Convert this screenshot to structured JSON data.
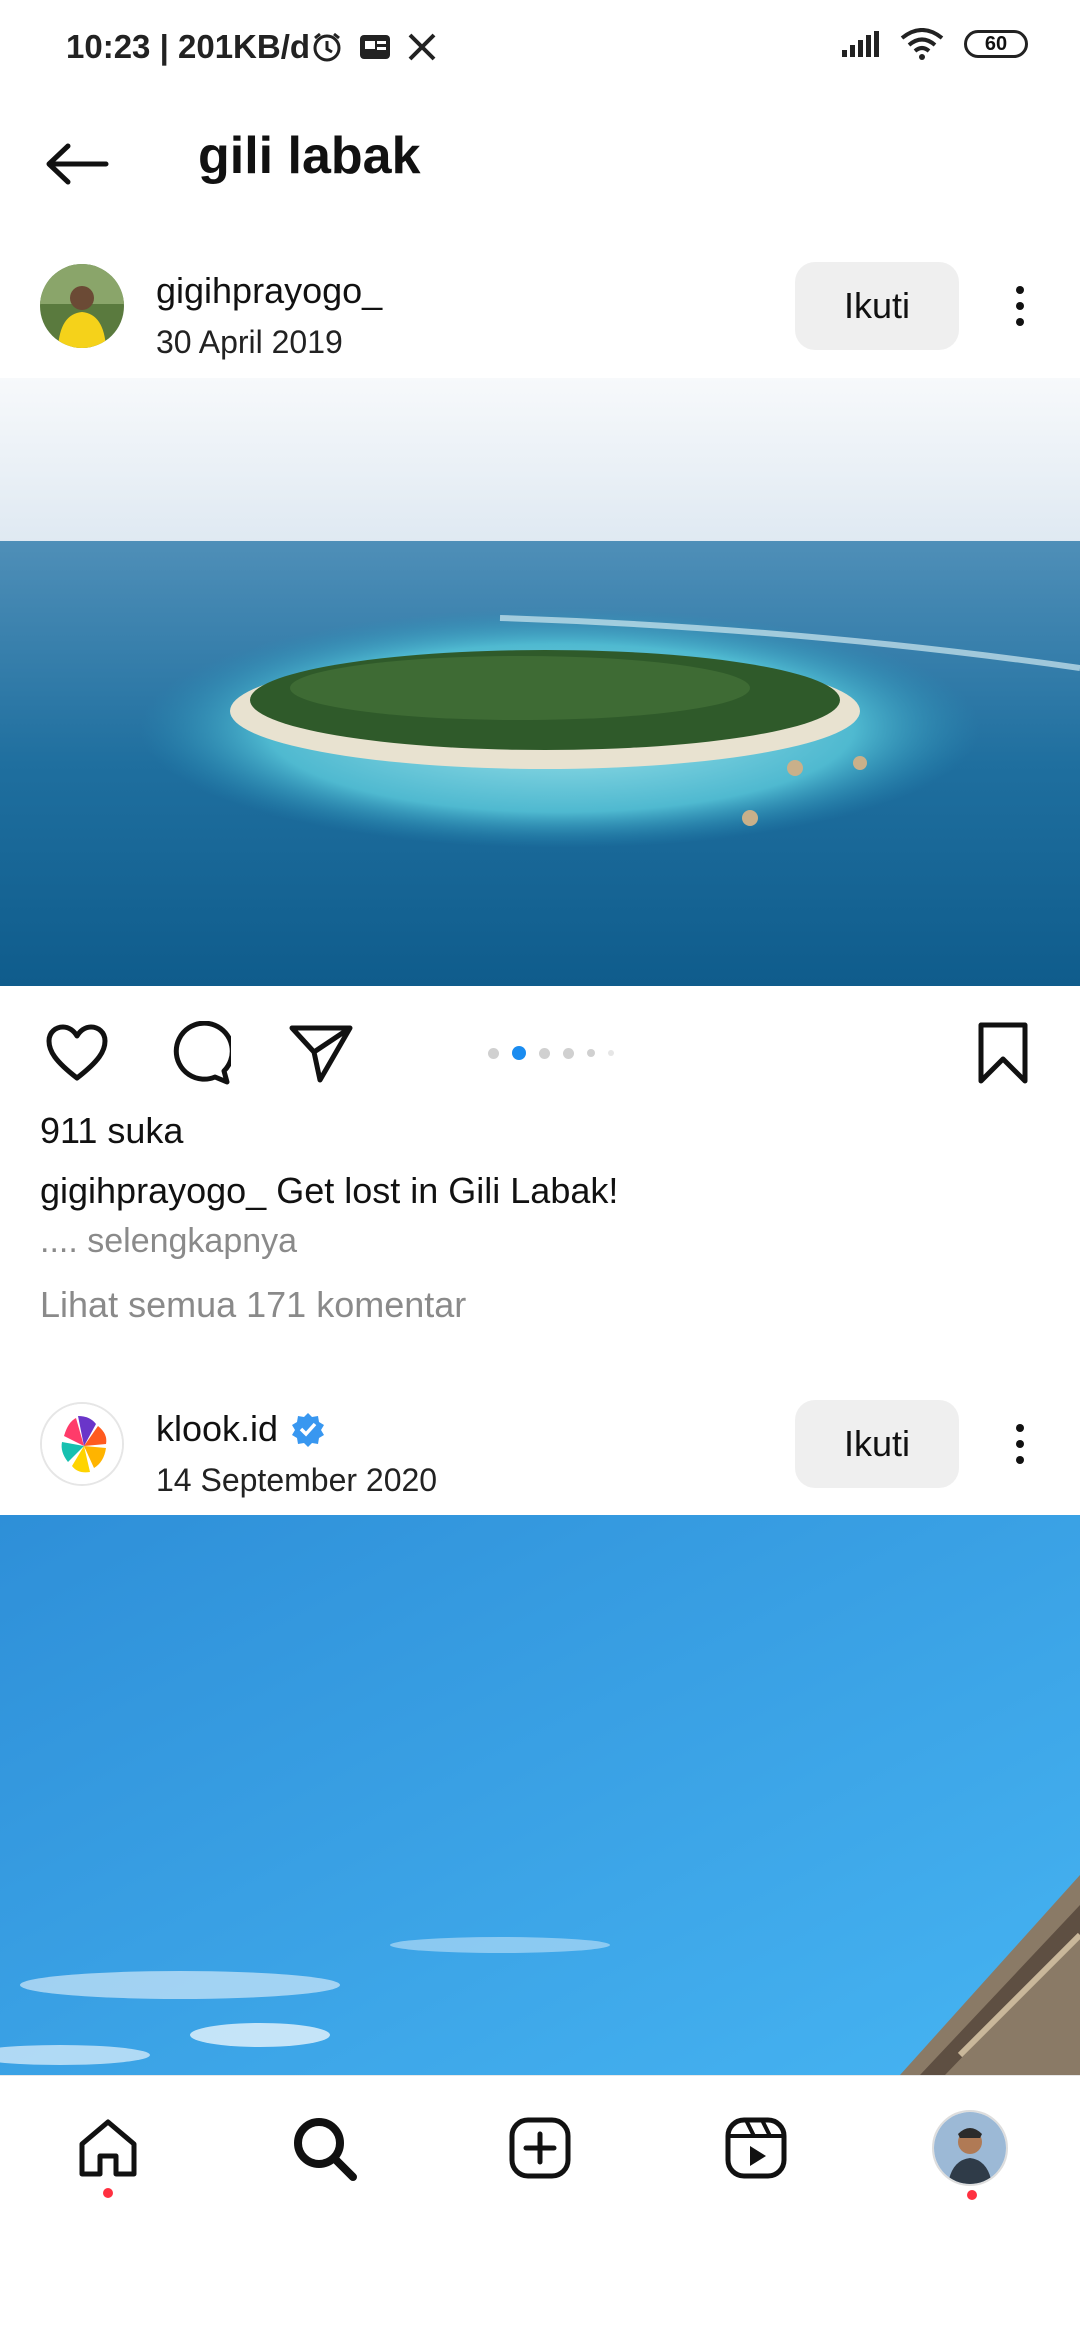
{
  "status_bar": {
    "time": "10:23",
    "speed": "201KB/d",
    "battery": "60"
  },
  "header": {
    "title": "gili labak"
  },
  "posts": [
    {
      "username": "gigihprayogo_",
      "date": "30 April 2019",
      "follow_label": "Ikuti",
      "likes": "911 suka",
      "caption_user": "gigihprayogo_",
      "caption_text": "Get lost in Gili Labak!",
      "more_label": ".... selengkapnya",
      "comments_label": "Lihat semua 171 komentar",
      "carousel_count": 6,
      "carousel_active": 2
    },
    {
      "username": "klook.id",
      "verified": true,
      "date": "14 September 2020",
      "follow_label": "Ikuti"
    }
  ],
  "bottom_nav": {
    "items": [
      "home",
      "search",
      "create",
      "reels",
      "profile"
    ]
  },
  "colors": {
    "accent": "#1a8cf0",
    "notification": "#ff3040",
    "follow_bg": "#efefef"
  }
}
